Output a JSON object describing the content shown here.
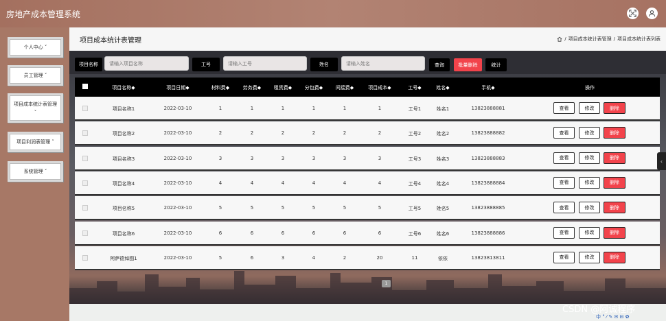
{
  "app": {
    "title": "房地产成本管理系统"
  },
  "topbar": {
    "fullscreen_icon": "fullscreen-icon",
    "user_icon": "user-icon"
  },
  "sidebar": {
    "items": [
      {
        "label": "个人中心 ˅"
      },
      {
        "label": "员工管理 ˅"
      },
      {
        "label": "项目成本统计表管理 ˅"
      },
      {
        "label": "项目利润表管理 ˅"
      },
      {
        "label": "系统管理 ˅"
      }
    ]
  },
  "page": {
    "title": "项目成本统计表管理",
    "breadcrumb": {
      "home_icon": "home-icon",
      "sep": "/",
      "level1": "项目成本统计表管理",
      "level2": "项目成本统计表列表"
    }
  },
  "search": {
    "project_label": "项目名称",
    "project_placeholder": "请输入项目名称",
    "empno_label": "工号",
    "empno_placeholder": "请输入工号",
    "name_label": "姓名",
    "name_placeholder": "请输入姓名",
    "query_btn": "查询",
    "batch_delete_btn": "批量删除",
    "stats_btn": "统计"
  },
  "table": {
    "headers": [
      "项目名称◆",
      "项目日期◆",
      "材料费◆",
      "劳务费◆",
      "租赁费◆",
      "分包费◆",
      "间接费◆",
      "项目成本◆",
      "工号◆",
      "姓名◆",
      "手机◆",
      "操作"
    ],
    "rows": [
      [
        "项目名称1",
        "2022-03-10",
        "1",
        "1",
        "1",
        "1",
        "1",
        "1",
        "工号1",
        "姓名1",
        "13823888881"
      ],
      [
        "项目名称2",
        "2022-03-10",
        "2",
        "2",
        "2",
        "2",
        "2",
        "2",
        "工号2",
        "姓名2",
        "13823888882"
      ],
      [
        "项目名称3",
        "2022-03-10",
        "3",
        "3",
        "3",
        "3",
        "3",
        "3",
        "工号3",
        "姓名3",
        "13823888883"
      ],
      [
        "项目名称4",
        "2022-03-10",
        "4",
        "4",
        "4",
        "4",
        "4",
        "4",
        "工号4",
        "姓名4",
        "13823888884"
      ],
      [
        "项目名称5",
        "2022-03-10",
        "5",
        "5",
        "5",
        "5",
        "5",
        "5",
        "工号5",
        "姓名5",
        "13823888885"
      ],
      [
        "项目名称6",
        "2022-03-10",
        "6",
        "6",
        "6",
        "6",
        "6",
        "6",
        "工号6",
        "姓名6",
        "13823888886"
      ],
      [
        "阿萨德如图1",
        "2022-03-10",
        "5",
        "6",
        "3",
        "4",
        "2",
        "20",
        "11",
        "依依",
        "13823813811"
      ]
    ],
    "actions": {
      "view": "查看",
      "edit": "修改",
      "delete": "删除"
    }
  },
  "pager": {
    "current": "1"
  },
  "watermark": "CSDN @阿诚程序",
  "tools_text": "中 ° ⁄ ✎ ✉ ⊟ ✿"
}
